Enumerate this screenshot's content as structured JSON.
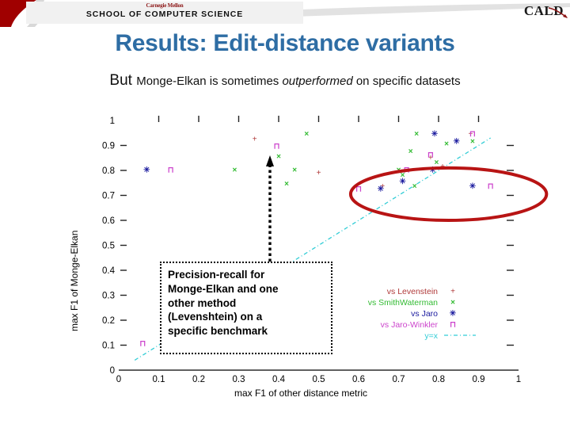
{
  "header": {
    "cmu_wordmark": "Carnegie Mellon",
    "school_name": "SCHOOL OF COMPUTER SCIENCE",
    "cald_logo": "CALD",
    "band_color": "#a00000"
  },
  "slide": {
    "title": "Results: Edit-distance variants",
    "title_color": "#2e6da4",
    "subtitle_lead": "But ",
    "subtitle_part1": "Monge-Elkan is sometimes ",
    "subtitle_emphasis": "outperformed",
    "subtitle_part2": " on specific datasets"
  },
  "callout": {
    "text": "Precision-recall for\nMonge-Elkan and one\nother method\n(Levenshtein) on a\nspecific benchmark",
    "border_style": "dotted",
    "arrow_color": "#000000"
  },
  "annotation": {
    "highlight_shape": "ellipse",
    "highlight_color": "#b81414",
    "highlight_center_x": 0.825,
    "highlight_center_y": 0.705,
    "highlight_rx": 0.245,
    "highlight_ry": 0.105
  },
  "chart_data": {
    "type": "scatter",
    "title": "",
    "xlabel": "max F1 of other distance metric",
    "ylabel": "max F1 of Monge-Elkan",
    "xlim": [
      0,
      1
    ],
    "ylim": [
      0,
      1
    ],
    "xticks": [
      "0",
      "0.1",
      "0.2",
      "0.3",
      "0.4",
      "0.5",
      "0.6",
      "0.7",
      "0.8",
      "0.9",
      "1"
    ],
    "yticks": [
      "0",
      "0.1",
      "0.2",
      "0.3",
      "0.4",
      "0.5",
      "0.6",
      "0.7",
      "0.8",
      "0.9",
      "1"
    ],
    "grid": false,
    "legend_position": "lower right",
    "reference_line": {
      "label": "y=x",
      "color": "#32cdd6",
      "style": "dashdot",
      "slope": 1,
      "intercept": 0
    },
    "series": [
      {
        "name": "vs Levenstein",
        "color": "#b03a3a",
        "marker": "+",
        "points": [
          [
            0.34,
            0.925
          ],
          [
            0.5,
            0.79
          ],
          [
            0.66,
            0.735
          ],
          [
            0.78,
            0.85
          ],
          [
            0.81,
            0.815
          ],
          [
            0.88,
            0.945
          ]
        ]
      },
      {
        "name": "vs SmithWaterman",
        "color": "#33bb33",
        "marker": "x",
        "points": [
          [
            0.29,
            0.8
          ],
          [
            0.44,
            0.8
          ],
          [
            0.4,
            0.855
          ],
          [
            0.47,
            0.945
          ],
          [
            0.42,
            0.745
          ],
          [
            0.7,
            0.8
          ],
          [
            0.71,
            0.78
          ],
          [
            0.745,
            0.945
          ],
          [
            0.73,
            0.875
          ],
          [
            0.82,
            0.905
          ],
          [
            0.74,
            0.735
          ],
          [
            0.885,
            0.915
          ],
          [
            0.795,
            0.83
          ]
        ]
      },
      {
        "name": "vs Jaro",
        "color": "#1a1a9e",
        "marker": "✳",
        "points": [
          [
            0.07,
            0.8
          ],
          [
            0.655,
            0.725
          ],
          [
            0.71,
            0.755
          ],
          [
            0.785,
            0.8
          ],
          [
            0.79,
            0.945
          ],
          [
            0.845,
            0.915
          ],
          [
            0.885,
            0.735
          ]
        ]
      },
      {
        "name": "vs Jaro-Winkler",
        "color": "#cc44cc",
        "marker": "⊓",
        "points": [
          [
            0.13,
            0.8
          ],
          [
            0.395,
            0.895
          ],
          [
            0.6,
            0.725
          ],
          [
            0.72,
            0.8
          ],
          [
            0.78,
            0.86
          ],
          [
            0.885,
            0.945
          ],
          [
            0.93,
            0.735
          ],
          [
            0.06,
            0.105
          ]
        ]
      }
    ]
  }
}
